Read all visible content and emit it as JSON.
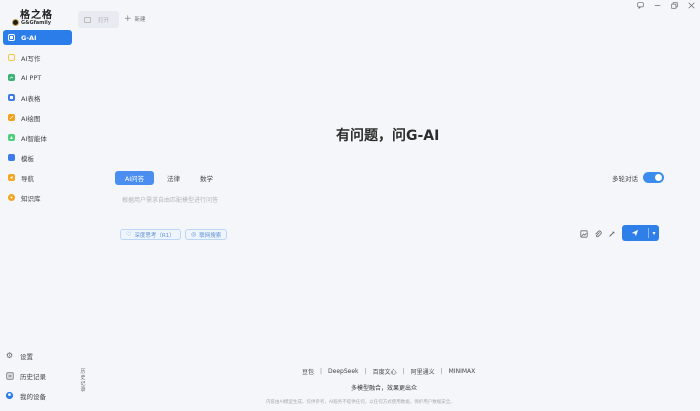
{
  "app": {
    "logo_title": "格之格",
    "logo_sub": "G&Gfamily"
  },
  "window": {
    "controls": [
      "feedback-icon",
      "minimize-icon",
      "restore-icon",
      "close-icon"
    ]
  },
  "tabs": {
    "open_label": "打开",
    "new_label": "新建"
  },
  "sidebar": {
    "items": [
      {
        "label": "G-AI",
        "icon": "gai-icon",
        "color": "#2b7de9",
        "active": true
      },
      {
        "label": "AI写作",
        "icon": "write-icon",
        "color": "#f5c542"
      },
      {
        "label": "AI PPT",
        "icon": "ppt-icon",
        "color": "#3bb273"
      },
      {
        "label": "AI表格",
        "icon": "table-icon",
        "color": "#3d7bea"
      },
      {
        "label": "AI绘图",
        "icon": "paint-icon",
        "color": "#f3a21c"
      },
      {
        "label": "AI智能体",
        "icon": "agent-icon",
        "color": "#4ccf7a"
      },
      {
        "label": "模板",
        "icon": "template-icon",
        "color": "#3d7bea"
      },
      {
        "label": "导航",
        "icon": "nav-icon",
        "color": "#f5a623"
      },
      {
        "label": "知识库",
        "icon": "knowledge-icon",
        "color": "#f3a21c"
      }
    ],
    "bottom": [
      {
        "label": "设置",
        "icon": "gear-icon"
      },
      {
        "label": "历史记录",
        "icon": "history-icon"
      },
      {
        "label": "我的设备",
        "icon": "device-icon"
      }
    ],
    "vertical_note": "历史记录"
  },
  "main": {
    "hero_title": "有问题，问G-AI",
    "mode_tabs": [
      "AI问答",
      "法律",
      "数学"
    ],
    "multi_turn_label": "多轮对话",
    "multi_turn_on": true,
    "prompt_placeholder": "根据用户需求自由匹配模型进行问答",
    "chips": [
      "深度思考（R1）",
      "联网搜索"
    ],
    "tools": [
      "image-icon",
      "attach-icon",
      "brush-icon"
    ],
    "send_icon": "send-icon"
  },
  "footer": {
    "models": [
      "豆包",
      "DeepSeek",
      "百度文心",
      "阿里通义",
      "MINIMAX"
    ],
    "tagline": "多模型融合，效果更出众",
    "note": "内容由AI模型生成，仅供参考，AI服务不提供任何，以任何方式使用数据，保护用户数据安全。"
  }
}
